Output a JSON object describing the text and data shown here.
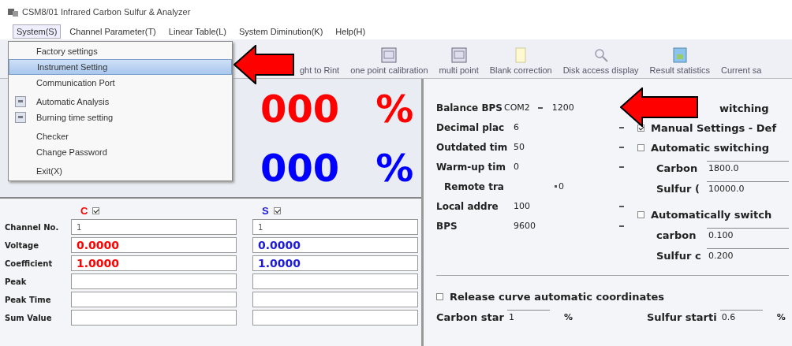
{
  "window": {
    "title": "CSM8/01 Infrared Carbon Sulfur & Analyzer"
  },
  "menubar": [
    {
      "label": "System(S)",
      "selected": true
    },
    {
      "label": "Channel Parameter(T)",
      "selected": false
    },
    {
      "label": "Linear Table(L)",
      "selected": false
    },
    {
      "label": "System Diminution(K)",
      "selected": false
    },
    {
      "label": "Help(H)",
      "selected": false
    }
  ],
  "system_menu": [
    {
      "label": "Factory settings",
      "selected": false,
      "kind": "plain"
    },
    {
      "label": "Instrument Setting",
      "selected": true,
      "kind": "plain"
    },
    {
      "label": "Communication Port",
      "selected": false,
      "kind": "plain"
    },
    {
      "label": "Automatic Analysis",
      "selected": false,
      "kind": "icon"
    },
    {
      "label": "Burning time setting",
      "selected": false,
      "kind": "icon"
    },
    {
      "label": "Checker",
      "selected": false,
      "kind": "plain"
    },
    {
      "label": "Change Password",
      "selected": false,
      "kind": "plain"
    },
    {
      "label": "Exit(X)",
      "selected": false,
      "kind": "plain"
    }
  ],
  "toolbar": [
    {
      "label": "ght to Rint",
      "kind": "none"
    },
    {
      "label": "one point calibration",
      "kind": "fx"
    },
    {
      "label": "multi point",
      "kind": "fx"
    },
    {
      "label": "Blank correction",
      "kind": "doc"
    },
    {
      "label": "Disk access display",
      "kind": "magnifier"
    },
    {
      "label": "Result statistics",
      "kind": "chart"
    },
    {
      "label": "Current sa",
      "kind": "none"
    }
  ],
  "readings": [
    {
      "value": "000",
      "unit": "%",
      "color": "#ff0000"
    },
    {
      "value": "000",
      "unit": "%",
      "color": "#0000ff"
    }
  ],
  "channels_table": {
    "columns": [
      {
        "label": "C",
        "checked": true,
        "color": "#ff0000"
      },
      {
        "label": "S",
        "checked": true,
        "color": "#1a1ad8"
      }
    ],
    "rows": [
      {
        "label": "Channel No.",
        "kind": "plain",
        "values": [
          "1",
          "1"
        ]
      },
      {
        "label": "Voltage",
        "kind": "colored",
        "values": [
          "0.0000",
          "0.0000"
        ]
      },
      {
        "label": "Coefficient",
        "kind": "colored",
        "values": [
          "1.0000",
          "1.0000"
        ]
      },
      {
        "label": "Peak",
        "kind": "plain"
      },
      {
        "label": "Peak Time",
        "kind": "plain"
      },
      {
        "label": "Sum Value",
        "kind": "plain"
      }
    ]
  },
  "instrument_settings": [
    {
      "label": "Balance BPS",
      "value": "COM2",
      "extra": "1200"
    },
    {
      "label": "Decimal plac",
      "value": "6"
    },
    {
      "label": "Outdated tim",
      "value": "50"
    },
    {
      "label": "Warm-up tim",
      "value": "0"
    },
    {
      "label": "Remote tra",
      "value": "0",
      "kind": "caret-first"
    },
    {
      "label": "Local addre",
      "value": "100"
    },
    {
      "label": "BPS",
      "value": "9600"
    }
  ],
  "switching_group": {
    "title": "witching",
    "options": [
      {
        "label": "Manual Settings - Def",
        "checked": true
      },
      {
        "label": "Automatic switching",
        "checked": false,
        "fields": [
          {
            "label": "Carbon",
            "value": "1800.0"
          },
          {
            "label": "Sulfur (",
            "value": "10000.0"
          }
        ]
      },
      {
        "label": "Automatically switch",
        "checked": false,
        "fields": [
          {
            "label": "carbon",
            "value": "0.100"
          },
          {
            "label": "Sulfur c",
            "value": "0.200"
          }
        ]
      }
    ]
  },
  "release_curve": {
    "label": "Release curve automatic coordinates",
    "checked": false,
    "fields": [
      {
        "label": "Carbon star",
        "value": "1",
        "unit": "%"
      },
      {
        "label": "Sulfur starti",
        "value": "0.6",
        "unit": "%"
      }
    ]
  }
}
